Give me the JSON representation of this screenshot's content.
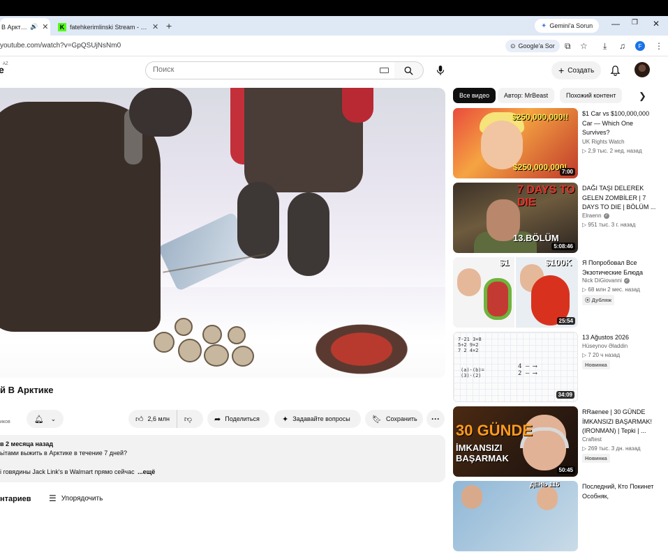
{
  "browser": {
    "tabs": [
      {
        "title": "В Арктике",
        "active": true
      },
      {
        "title": "fatehkerimlinski Stream - Watch",
        "active": false
      }
    ],
    "gemini_label": "Gemini'a Sorun",
    "url": "youtube.com/watch?v=GpQSUjNsNm0",
    "google_sor_label": "Google'a Sor",
    "profile_initial": "F"
  },
  "yt_header": {
    "logo_fragment": "e",
    "region": "AZ",
    "search_placeholder": "Поиск",
    "create_label": "Создать"
  },
  "video": {
    "title": "й В Арктике",
    "channel_fragment": "иков",
    "like_count": "2,6 млн",
    "share_label": "Поделиться",
    "ask_label": "Задавайте вопросы",
    "save_label": "Сохранить",
    "description": {
      "views_date": "в  2 месяца назад",
      "line1": "ьітами выжить в Арктике в течение 7 дней?",
      "line2": "і говядины Jack Link's в Walmart прямо сейчас",
      "more": "...ещё"
    }
  },
  "comments": {
    "title": "нтариев",
    "sort_label": "Упорядочить"
  },
  "sidebar": {
    "chips": [
      "Все видео",
      "Автор: MrBeast",
      "Похожий контент"
    ],
    "recommendations": [
      {
        "title": "$1 Car vs $100,000,000 Car — Which One Survives?",
        "channel": "UK Rights Watch",
        "verified": false,
        "meta": "▷ 2,9 тыс.  2 нед. назад",
        "duration": "7:00",
        "badge": "",
        "thumb_text_top": "$250,000,000!!",
        "thumb_text_bottom": "$250,000,000!"
      },
      {
        "title": "DAĞI TAŞI DELEREK GELEN ZOMBİLER | 7 DAYS TO DIE | BÖLÜM ...",
        "channel": "Elraenn",
        "verified": true,
        "meta": "▷ 951 тыс.  3 г. назад",
        "duration": "5:08:46",
        "badge": "",
        "thumb_text_top": "7 DAYS TO DIE",
        "thumb_text_bottom": "13.BÖLÜM"
      },
      {
        "title": "Я Попробовал Все Экзотические Блюда",
        "channel": "Nick DiGiovanni",
        "verified": true,
        "meta": "▷ 68 млн  2 мес. назад",
        "duration": "25:54",
        "badge": "Дубляж",
        "thumb_text_top": "$1",
        "thumb_text_bottom": "$100K"
      },
      {
        "title": "13 Ağustos 2026",
        "channel": "Hüseynov Əladdin",
        "verified": false,
        "meta": "▷ 7  20 ч назад",
        "duration": "34:09",
        "badge": "Новинка",
        "thumb_text_top": "",
        "thumb_text_bottom": ""
      },
      {
        "title": "RRaenee | 30 GÜNDE İMKANSIZI BAŞARMAK! (IRONMAN) | Tepki | ...",
        "channel": "Craftest",
        "verified": false,
        "meta": "▷ 269 тыс.  3 дн. назад",
        "duration": "50:45",
        "badge": "Новинка",
        "thumb_text_top": "30 GÜNDE",
        "thumb_text_bottom": "İMKANSIZI BAŞARMAK"
      },
      {
        "title": "Последний, Кто Покинет Особняк,",
        "channel": "",
        "verified": false,
        "meta": "",
        "duration": "",
        "badge": "",
        "thumb_text_top": "ДЕНЬ 115",
        "thumb_text_bottom": ""
      }
    ]
  }
}
